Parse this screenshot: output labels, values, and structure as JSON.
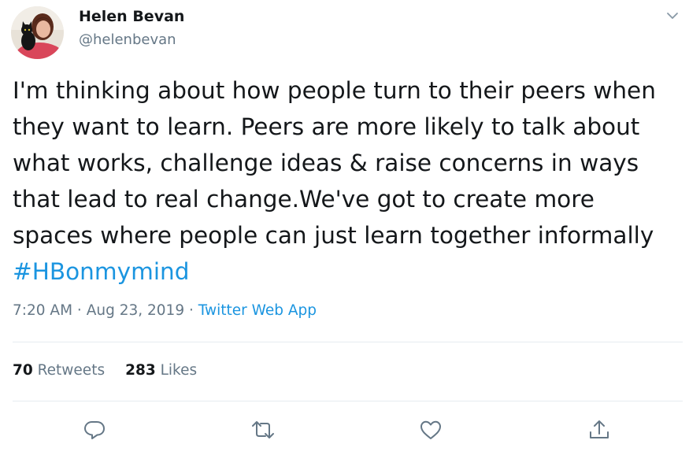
{
  "user": {
    "name": "Helen Bevan",
    "handle": "@helenbevan"
  },
  "tweet": {
    "lines": [
      "I'm thinking about how people turn to their peers when",
      "they want to learn. Peers are more likely to talk about",
      "what works, challenge ideas & raise concerns in ways",
      "that lead to real change.We've got to create more",
      "spaces where people can just learn together informally"
    ],
    "hashtag": "#HBonmymind"
  },
  "meta": {
    "time": "7:20 AM",
    "separator": " · ",
    "date": "Aug 23, 2019",
    "separator2": " · ",
    "source": "Twitter Web App"
  },
  "stats": {
    "retweets_count": "70",
    "retweets_label": "Retweets",
    "likes_count": "283",
    "likes_label": "Likes"
  },
  "colors": {
    "link": "#1b95e0",
    "secondary": "#657786",
    "divider": "#e6ecf0",
    "text": "#14171a"
  },
  "icons": {
    "menu": "chevron-down-icon",
    "reply": "reply-icon",
    "retweet": "retweet-icon",
    "like": "heart-icon",
    "share": "share-icon"
  }
}
